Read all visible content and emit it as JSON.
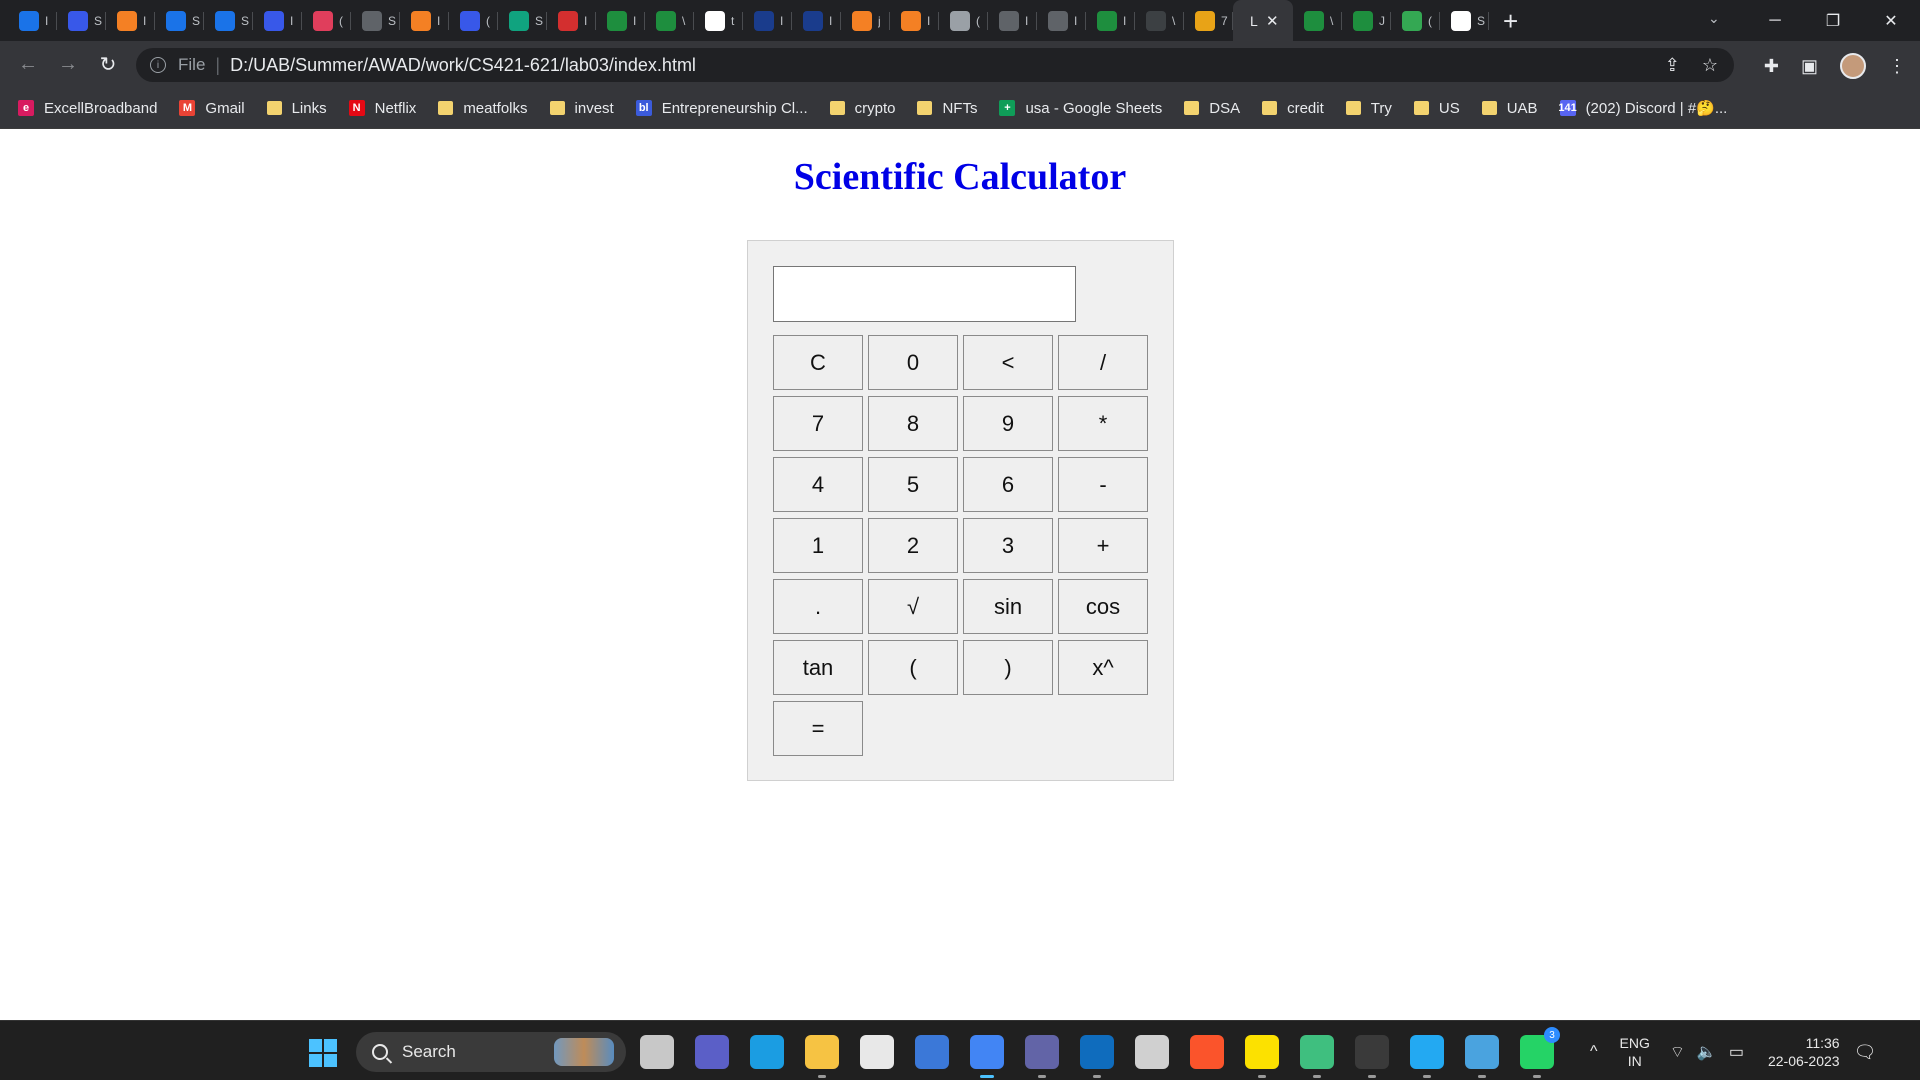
{
  "browser": {
    "tabs": [
      {
        "fav_color": "#1a73e8",
        "cut": "I",
        "icon": "image-icon"
      },
      {
        "fav_color": "#3858e9",
        "cut": "S",
        "icon": "wordpress-icon"
      },
      {
        "fav_color": "#f48024",
        "cut": "I",
        "icon": "stackoverflow-icon"
      },
      {
        "fav_color": "#1a73e8",
        "cut": "S",
        "icon": "image-icon"
      },
      {
        "fav_color": "#1a73e8",
        "cut": "S",
        "icon": "image-icon"
      },
      {
        "fav_color": "#3858e9",
        "cut": "I",
        "icon": "wordpress-icon"
      },
      {
        "fav_color": "#e03e5c",
        "cut": "(",
        "icon": "dots-icon"
      },
      {
        "fav_color": "#5f6368",
        "cut": "S",
        "icon": "app-icon"
      },
      {
        "fav_color": "#f48024",
        "cut": "I",
        "icon": "stackoverflow-icon"
      },
      {
        "fav_color": "#3858e9",
        "cut": "(",
        "icon": "wordpress-icon"
      },
      {
        "fav_color": "#10a37f",
        "cut": "S",
        "icon": "chatgpt-icon"
      },
      {
        "fav_color": "#d32f2f",
        "cut": "I",
        "icon": "wp-icon"
      },
      {
        "fav_color": "#1e8e3e",
        "cut": "I",
        "icon": "w-icon"
      },
      {
        "fav_color": "#1e8e3e",
        "cut": "\\",
        "icon": "w-icon"
      },
      {
        "fav_color": "#ffffff",
        "cut": "t",
        "icon": "google-icon"
      },
      {
        "fav_color": "#1a3c8c",
        "cut": "I",
        "icon": "uab-icon"
      },
      {
        "fav_color": "#1a3c8c",
        "cut": "I",
        "icon": "uab-icon"
      },
      {
        "fav_color": "#f48024",
        "cut": "j",
        "icon": "stackoverflow-icon"
      },
      {
        "fav_color": "#f48024",
        "cut": "I",
        "icon": "stackoverflow-icon"
      },
      {
        "fav_color": "#9aa0a6",
        "cut": "(",
        "icon": "app-icon"
      },
      {
        "fav_color": "#5f6368",
        "cut": "I",
        "icon": "globe-icon"
      },
      {
        "fav_color": "#5f6368",
        "cut": "I",
        "icon": "globe-icon"
      },
      {
        "fav_color": "#1e8e3e",
        "cut": "I",
        "icon": "uab-icon"
      },
      {
        "fav_color": "#3c4043",
        "cut": "\\",
        "icon": "p-icon"
      },
      {
        "fav_color": "#e8a317",
        "cut": "7",
        "icon": "mountain-icon"
      }
    ],
    "active_tab": {
      "cut": "L",
      "close": "✕"
    },
    "tabs_after": [
      {
        "fav_color": "#1e8e3e",
        "cut": "\\",
        "icon": "w-icon"
      },
      {
        "fav_color": "#1e8e3e",
        "cut": "J",
        "icon": "w-icon"
      },
      {
        "fav_color": "#34a853",
        "cut": "(",
        "icon": "maps-icon"
      },
      {
        "fav_color": "#ffffff",
        "cut": "S",
        "icon": "google-icon"
      }
    ],
    "new_tab": "+",
    "window_controls": [
      "─",
      "❐",
      "✕"
    ],
    "tab_search": "⌄",
    "address": {
      "file_label": "File",
      "url": "D:/UAB/Summer/AWAD/work/CS421-621/lab03/index.html"
    },
    "bookmarks": [
      {
        "label": "ExcellBroadband",
        "kind": "icon",
        "color": "#d81b60",
        "glyph": "e"
      },
      {
        "label": "Gmail",
        "kind": "icon",
        "color": "#ea4335",
        "glyph": "M"
      },
      {
        "label": "Links",
        "kind": "folder"
      },
      {
        "label": "Netflix",
        "kind": "icon",
        "color": "#e50914",
        "glyph": "N"
      },
      {
        "label": "meatfolks",
        "kind": "folder"
      },
      {
        "label": "invest",
        "kind": "folder"
      },
      {
        "label": "Entrepreneurship Cl...",
        "kind": "icon",
        "color": "#3b5bdb",
        "glyph": "bl"
      },
      {
        "label": "crypto",
        "kind": "folder"
      },
      {
        "label": "NFTs",
        "kind": "folder"
      },
      {
        "label": "usa - Google Sheets",
        "kind": "icon",
        "color": "#0f9d58",
        "glyph": "+"
      },
      {
        "label": "DSA",
        "kind": "folder"
      },
      {
        "label": "credit",
        "kind": "folder"
      },
      {
        "label": "Try",
        "kind": "folder"
      },
      {
        "label": "US",
        "kind": "folder"
      },
      {
        "label": "UAB",
        "kind": "folder"
      },
      {
        "label": "(202) Discord | #🤔...",
        "kind": "icon",
        "color": "#5865f2",
        "glyph": "141"
      }
    ]
  },
  "page": {
    "title": "Scientific Calculator",
    "display_value": "",
    "keys": [
      "C",
      "0",
      "<",
      "/",
      "7",
      "8",
      "9",
      "*",
      "4",
      "5",
      "6",
      "-",
      "1",
      "2",
      "3",
      "+",
      ".",
      "√",
      "sin",
      "cos",
      "tan",
      "(",
      ")",
      "x^",
      "="
    ]
  },
  "taskbar": {
    "search_placeholder": "Search",
    "apps": [
      {
        "name": "task-view-icon",
        "color": "#c8c8c8",
        "run": false
      },
      {
        "name": "meet-icon",
        "color": "#5b5fc7",
        "run": false
      },
      {
        "name": "edge-icon",
        "color": "#1b9de2",
        "run": false
      },
      {
        "name": "file-explorer-icon",
        "color": "#f6c343",
        "run": true
      },
      {
        "name": "store-icon",
        "color": "#e8e8e8",
        "run": false
      },
      {
        "name": "pdf-icon",
        "color": "#3b78d8",
        "run": false
      },
      {
        "name": "chrome-icon",
        "color": "#4285f4",
        "run": true,
        "focus": true
      },
      {
        "name": "teams-icon",
        "color": "#6264a7",
        "run": true
      },
      {
        "name": "outlook-icon",
        "color": "#0f6cbd",
        "run": true
      },
      {
        "name": "clock-app-icon",
        "color": "#d0d0d0",
        "run": false
      },
      {
        "name": "brave-icon",
        "color": "#fb542b",
        "run": false
      },
      {
        "name": "sticky-notes-icon",
        "color": "#fce100",
        "run": true
      },
      {
        "name": "gem-app-icon",
        "color": "#3fbf7f",
        "run": true
      },
      {
        "name": "terminal-icon",
        "color": "#3a3a3a",
        "run": true
      },
      {
        "name": "vscode-icon",
        "color": "#23a9f2",
        "run": true
      },
      {
        "name": "notepad-icon",
        "color": "#4aa3df",
        "run": true
      },
      {
        "name": "whatsapp-icon",
        "color": "#25d366",
        "run": true,
        "badge": "3"
      }
    ],
    "tray": {
      "chevron": "^",
      "lang_top": "ENG",
      "lang_bottom": "IN",
      "time": "11:36",
      "date": "22-06-2023"
    }
  }
}
